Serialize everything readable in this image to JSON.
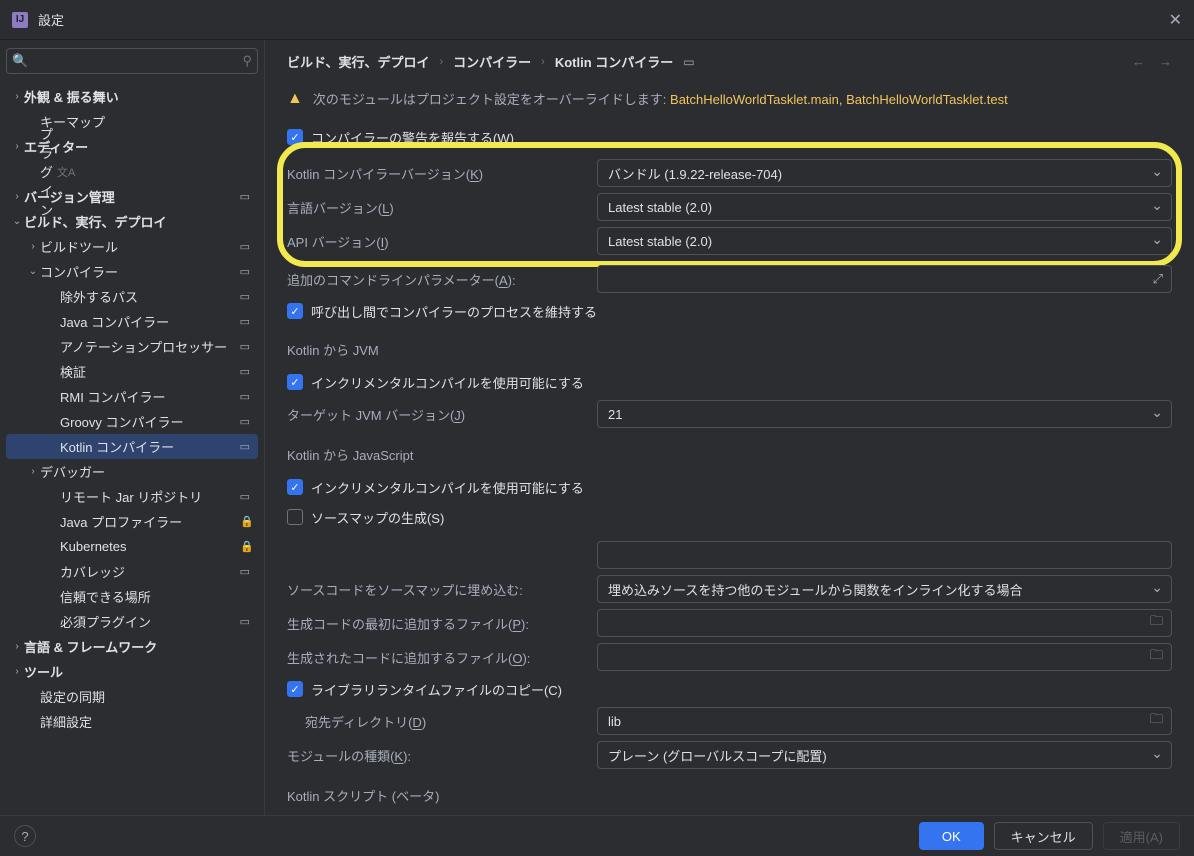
{
  "title": "設定",
  "search": {
    "placeholder": ""
  },
  "sidebar": {
    "items": [
      {
        "label": "外観 & 振る舞い",
        "expandable": true,
        "open": false,
        "bold": true
      },
      {
        "label": "キーマップ",
        "indent": 1
      },
      {
        "label": "エディター",
        "expandable": true,
        "open": false,
        "bold": true
      },
      {
        "label": "プラグイン",
        "indent": 1,
        "lang": true
      },
      {
        "label": "バージョン管理",
        "expandable": true,
        "open": false,
        "bold": true,
        "mod": true
      },
      {
        "label": "ビルド、実行、デプロイ",
        "expandable": true,
        "open": true,
        "bold": true
      },
      {
        "label": "ビルドツール",
        "expandable": true,
        "open": false,
        "indent": 1,
        "mod": true
      },
      {
        "label": "コンパイラー",
        "expandable": true,
        "open": true,
        "indent": 1,
        "mod": true
      },
      {
        "label": "除外するパス",
        "indent": 2,
        "mod": true
      },
      {
        "label": "Java コンパイラー",
        "indent": 2,
        "mod": true
      },
      {
        "label": "アノテーションプロセッサー",
        "indent": 2,
        "mod": true
      },
      {
        "label": "検証",
        "indent": 2,
        "mod": true
      },
      {
        "label": "RMI コンパイラー",
        "indent": 2,
        "mod": true
      },
      {
        "label": "Groovy コンパイラー",
        "indent": 2,
        "mod": true
      },
      {
        "label": "Kotlin コンパイラー",
        "indent": 2,
        "mod": true,
        "selected": true
      },
      {
        "label": "デバッガー",
        "expandable": true,
        "open": false,
        "indent": 1
      },
      {
        "label": "リモート Jar リポジトリ",
        "indent": 2,
        "mod": true
      },
      {
        "label": "Java プロファイラー",
        "indent": 2,
        "lock": true
      },
      {
        "label": "Kubernetes",
        "indent": 2,
        "lock": true
      },
      {
        "label": "カバレッジ",
        "indent": 2,
        "mod": true
      },
      {
        "label": "信頼できる場所",
        "indent": 2
      },
      {
        "label": "必須プラグイン",
        "indent": 2,
        "mod": true
      },
      {
        "label": "言語 & フレームワーク",
        "expandable": true,
        "open": false,
        "bold": true
      },
      {
        "label": "ツール",
        "expandable": true,
        "open": false,
        "bold": true
      },
      {
        "label": "設定の同期",
        "indent": 1
      },
      {
        "label": "詳細設定",
        "indent": 1
      }
    ]
  },
  "breadcrumb": {
    "part1": "ビルド、実行、デプロイ",
    "part2": "コンパイラー",
    "part3": "Kotlin コンパイラー"
  },
  "warning": {
    "prefix": "次のモジュールはプロジェクト設定をオーバーライドします: ",
    "modules": "BatchHelloWorldTasklet.main, BatchHelloWorldTasklet.test"
  },
  "form": {
    "reportWarnings": "コンパイラーの警告を報告する(W)",
    "compilerVersion": {
      "label": "Kotlin コンパイラーバージョン(K)",
      "value": "バンドル (1.9.22-release-704)"
    },
    "langVersion": {
      "label": "言語バージョン(L)",
      "value": "Latest stable (2.0)"
    },
    "apiVersion": {
      "label": "API バージョン(I)",
      "value": "Latest stable (2.0)"
    },
    "cmdParams": {
      "label": "追加のコマンドラインパラメーター(A):"
    },
    "keepProcess": "呼び出し間でコンパイラーのプロセスを維持する",
    "jvmSection": "Kotlin から JVM",
    "incremental1": "インクリメンタルコンパイルを使用可能にする",
    "targetJvm": {
      "label": "ターゲット JVM バージョン(J)",
      "value": "21"
    },
    "jsSection": "Kotlin から JavaScript",
    "incremental2": "インクリメンタルコンパイルを使用可能にする",
    "sourcemap": "ソースマップの生成(S)",
    "embedSource": {
      "label": "ソースコードをソースマップに埋め込む:",
      "value": "埋め込みソースを持つ他のモジュールから関数をインライン化する場合"
    },
    "prepend": {
      "label": "生成コードの最初に追加するファイル(P):"
    },
    "append": {
      "label": "生成されたコードに追加するファイル(O):"
    },
    "copyRuntime": "ライブラリランタイムファイルのコピー(C)",
    "destDir": {
      "label": "宛先ディレクトリ(D)",
      "value": "lib"
    },
    "moduleKind": {
      "label": "モジュールの種類(K):",
      "value": "プレーン (グローバルスコープに配置)"
    },
    "scriptSection": "Kotlin スクリプト (ベータ)"
  },
  "footer": {
    "ok": "OK",
    "cancel": "キャンセル",
    "apply": "適用(A)"
  }
}
